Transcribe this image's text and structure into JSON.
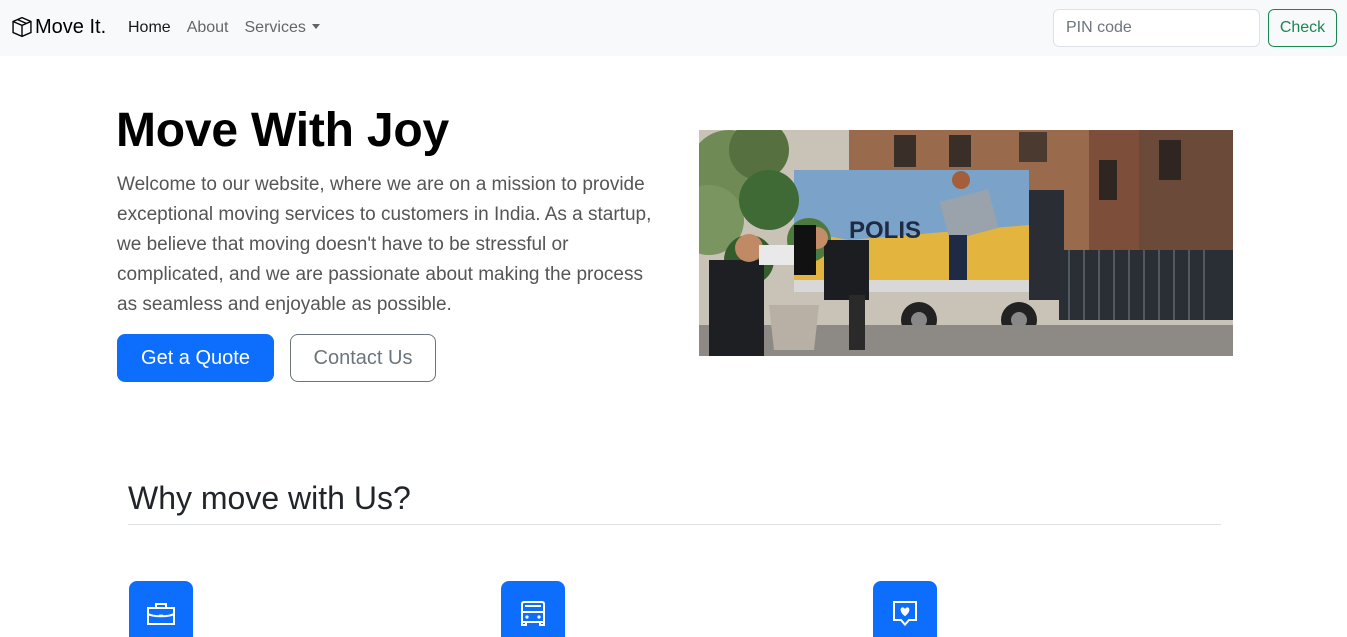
{
  "navbar": {
    "brand": "Move It.",
    "brand_icon": "box-icon",
    "links": [
      {
        "label": "Home",
        "active": true
      },
      {
        "label": "About",
        "active": false
      },
      {
        "label": "Services",
        "active": false,
        "dropdown": true
      }
    ],
    "pin_placeholder": "PIN code",
    "check_label": "Check"
  },
  "hero": {
    "title": "Move With Joy",
    "text": "Welcome to our website, where we are on a mission to provide exceptional moving services to customers in India. As a startup, we believe that moving doesn't have to be stressful or complicated, and we are passionate about making the process as seamless and enjoyable as possible.",
    "primary_button": "Get a Quote",
    "secondary_button": "Contact Us",
    "image_text": "POLIS"
  },
  "features_section": {
    "title": "Why move with Us?",
    "icons": [
      "briefcase-icon",
      "bus-icon",
      "chat-heart-icon"
    ]
  },
  "colors": {
    "primary": "#0d6efd",
    "success": "#198754",
    "navbar_bg": "#f8f9fa",
    "secondary": "#6c757d"
  }
}
